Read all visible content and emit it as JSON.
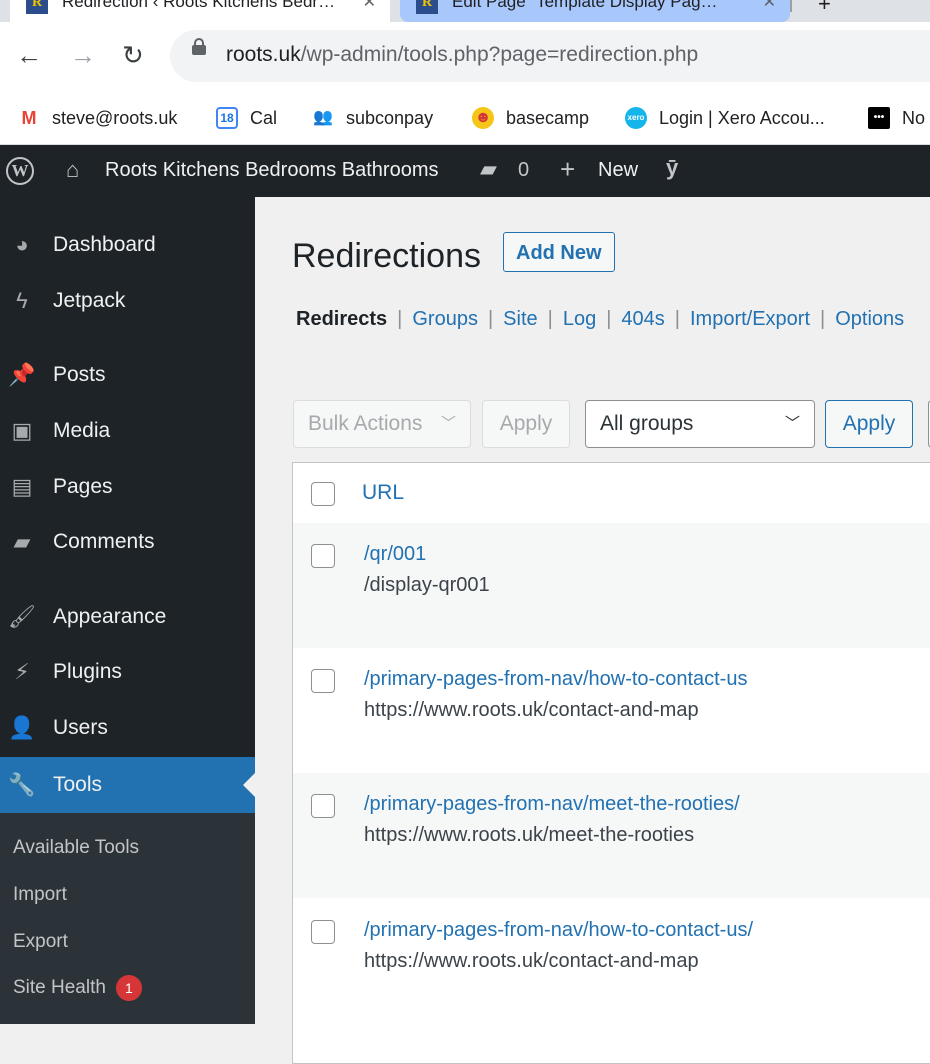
{
  "browser": {
    "tabs": [
      {
        "title": "Redirection ‹ Roots Kitchens Bedr…",
        "close": "✕"
      },
      {
        "title": "Edit Page “Template Display Pag…",
        "close": "✕"
      }
    ],
    "new_tab": "+",
    "url_host": "roots.uk",
    "url_path": "/wp-admin/tools.php?page=redirection.php",
    "bookmarks": [
      {
        "label": "steve@roots.uk",
        "icon": "gmail-icon",
        "glyph": "M",
        "color": "#ea4335"
      },
      {
        "label": "Cal",
        "icon": "calendar-icon",
        "glyph": "18",
        "color": "#4285f4"
      },
      {
        "label": "subconpay",
        "icon": "people-icon",
        "glyph": "👥",
        "color": "#4285f4"
      },
      {
        "label": "basecamp",
        "icon": "basecamp-icon",
        "glyph": "☻",
        "color": "#f5a623"
      },
      {
        "label": "Login | Xero Accou...",
        "icon": "xero-icon",
        "glyph": "xero",
        "color": "#13b5ea"
      },
      {
        "label": "No",
        "icon": "notion-icon",
        "glyph": "•••",
        "color": "#000000"
      }
    ]
  },
  "adminbar": {
    "site_name": "Roots Kitchens Bedrooms Bathrooms",
    "comments_count": "0",
    "new_label": "New"
  },
  "sidebar": {
    "items": [
      {
        "label": "Dashboard",
        "icon": "dashboard-icon",
        "glyph": "◕"
      },
      {
        "label": "Jetpack",
        "icon": "jetpack-icon",
        "glyph": "ϟ"
      },
      {
        "label": "Posts",
        "icon": "pin-icon",
        "glyph": "📌"
      },
      {
        "label": "Media",
        "icon": "media-icon",
        "glyph": "▣"
      },
      {
        "label": "Pages",
        "icon": "pages-icon",
        "glyph": "▤"
      },
      {
        "label": "Comments",
        "icon": "comment-icon",
        "glyph": "▰"
      },
      {
        "label": "Appearance",
        "icon": "brush-icon",
        "glyph": "🖌"
      },
      {
        "label": "Plugins",
        "icon": "plugin-icon",
        "glyph": "⚡"
      },
      {
        "label": "Users",
        "icon": "user-icon",
        "glyph": "👤"
      },
      {
        "label": "Tools",
        "icon": "wrench-icon",
        "glyph": "🔧"
      }
    ],
    "submenu": [
      "Available Tools",
      "Import",
      "Export",
      "Site Health"
    ],
    "site_health_badge": "1"
  },
  "main": {
    "title": "Redirections",
    "add_new": "Add New",
    "subnav": [
      "Redirects",
      "Groups",
      "Site",
      "Log",
      "404s",
      "Import/Export",
      "Options"
    ],
    "bulk_actions": "Bulk Actions",
    "apply": "Apply",
    "groups_select": "All groups",
    "column_url": "URL",
    "rows": [
      {
        "source": "/qr/001",
        "target": "/display-qr001"
      },
      {
        "source": "/primary-pages-from-nav/how-to-contact-us",
        "target": "https://www.roots.uk/contact-and-map"
      },
      {
        "source": "/primary-pages-from-nav/meet-the-rooties/",
        "target": "https://www.roots.uk/meet-the-rooties"
      },
      {
        "source": "/primary-pages-from-nav/how-to-contact-us/",
        "target": "https://www.roots.uk/contact-and-map"
      }
    ]
  }
}
